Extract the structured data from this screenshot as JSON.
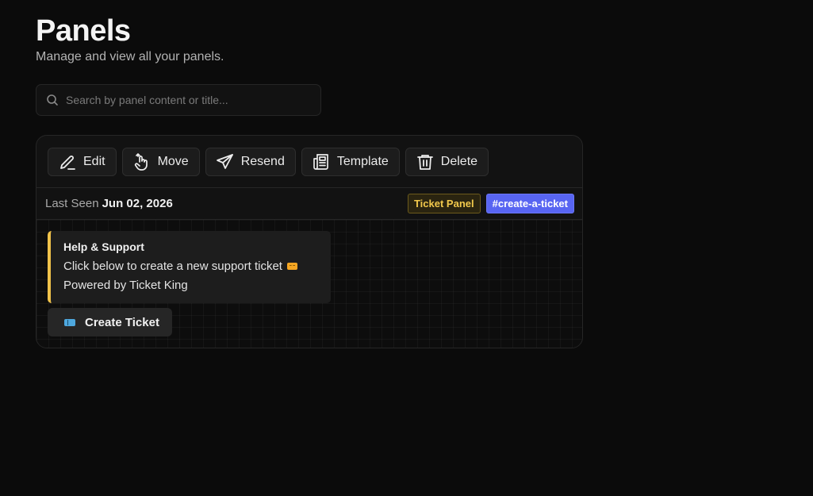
{
  "header": {
    "title": "Panels",
    "subtitle": "Manage and view all your panels."
  },
  "search": {
    "placeholder": "Search by panel content or title...",
    "value": "",
    "icon": "search-icon"
  },
  "panel": {
    "toolbar": [
      {
        "label": "Edit",
        "icon": "pencil-icon"
      },
      {
        "label": "Move",
        "icon": "hand-pointer-icon"
      },
      {
        "label": "Resend",
        "icon": "send-icon"
      },
      {
        "label": "Template",
        "icon": "newspaper-icon"
      },
      {
        "label": "Delete",
        "icon": "trash-icon"
      }
    ],
    "last_seen_label": "Last Seen",
    "last_seen_date": "Jun 02, 2026",
    "badges": {
      "type": "Ticket Panel",
      "channel": "#create-a-ticket"
    },
    "embed": {
      "title": "Help & Support",
      "description": "Click below to create a new support ticket",
      "footer": "Powered by Ticket King",
      "accent_color": "#f0c24a"
    },
    "button": {
      "label": "Create Ticket",
      "icon": "ticket-icon"
    }
  },
  "colors": {
    "background": "#0b0b0b",
    "card": "#121212",
    "channel_badge": "#5865f2",
    "ticket_badge_text": "#f2c94c"
  }
}
